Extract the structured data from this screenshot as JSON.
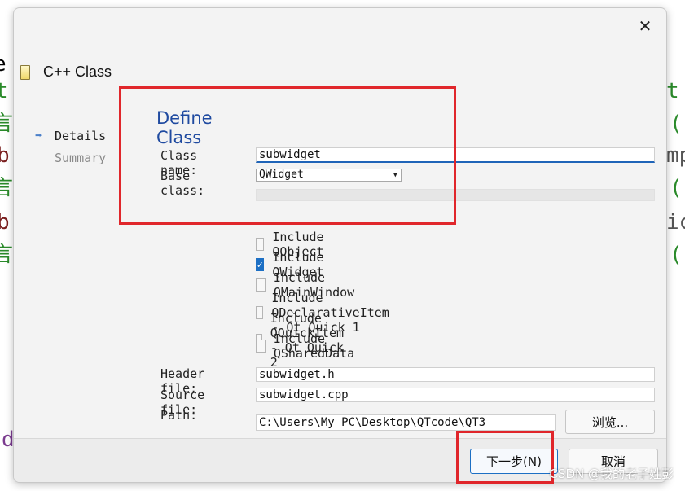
{
  "background_code": [
    {
      "text": "e",
      "color": "c-gray"
    },
    {
      "text": "t",
      "color": "c-green"
    },
    {
      "text": "言",
      "color": "c-green"
    },
    {
      "text": "b",
      "color": "c-maroon"
    },
    {
      "text": "言",
      "color": "c-green"
    },
    {
      "text": "b",
      "color": "c-maroon"
    },
    {
      "text": "言",
      "color": "c-green"
    },
    {
      "text": "d",
      "color": "c-purple"
    }
  ],
  "background_code_right": [
    {
      "text": "t",
      "color": "c-green"
    },
    {
      "text": "(",
      "color": "c-green"
    },
    {
      "text": "mp",
      "color": "c-gray"
    },
    {
      "text": "(",
      "color": "c-green"
    },
    {
      "text": "ic",
      "color": "c-gray"
    },
    {
      "text": "(",
      "color": "c-green"
    }
  ],
  "dialog": {
    "close_symbol": "✕",
    "wizard_title": "C++ Class"
  },
  "sidebar": {
    "items": [
      {
        "label": "Details",
        "state": "active"
      },
      {
        "label": "Summary",
        "state": "inactive"
      }
    ]
  },
  "form": {
    "heading": "Define Class",
    "class_name_label": "Class name:",
    "class_name_value": "subwidget",
    "base_class_label": "Base class:",
    "base_class_value": "QWidget",
    "checkboxes": [
      {
        "label": "Include QObject",
        "checked": false
      },
      {
        "label": "Include QWidget",
        "checked": true
      },
      {
        "label": "Include QMainWindow",
        "checked": false
      },
      {
        "label": "Include QDeclarativeItem - Qt Quick 1",
        "checked": false
      },
      {
        "label": "Include QQuickItem - Qt Quick 2",
        "checked": false
      },
      {
        "label": "Include QSharedData",
        "checked": false
      }
    ],
    "header_file_label": "Header file:",
    "header_file_value": "subwidget.h",
    "source_file_label": "Source file:",
    "source_file_value": "subwidget.cpp",
    "path_label": "Path:",
    "path_value": "C:\\Users\\My PC\\Desktop\\QTcode\\QT3",
    "browse_label": "浏览..."
  },
  "footer": {
    "next_label": "下一步(N)",
    "cancel_label": "取消"
  },
  "watermark": "CSDN @我的老子姓彭",
  "colors": {
    "accent": "#1c6fc4",
    "heading": "#1f4aa0",
    "highlight_box": "#e0262b"
  }
}
